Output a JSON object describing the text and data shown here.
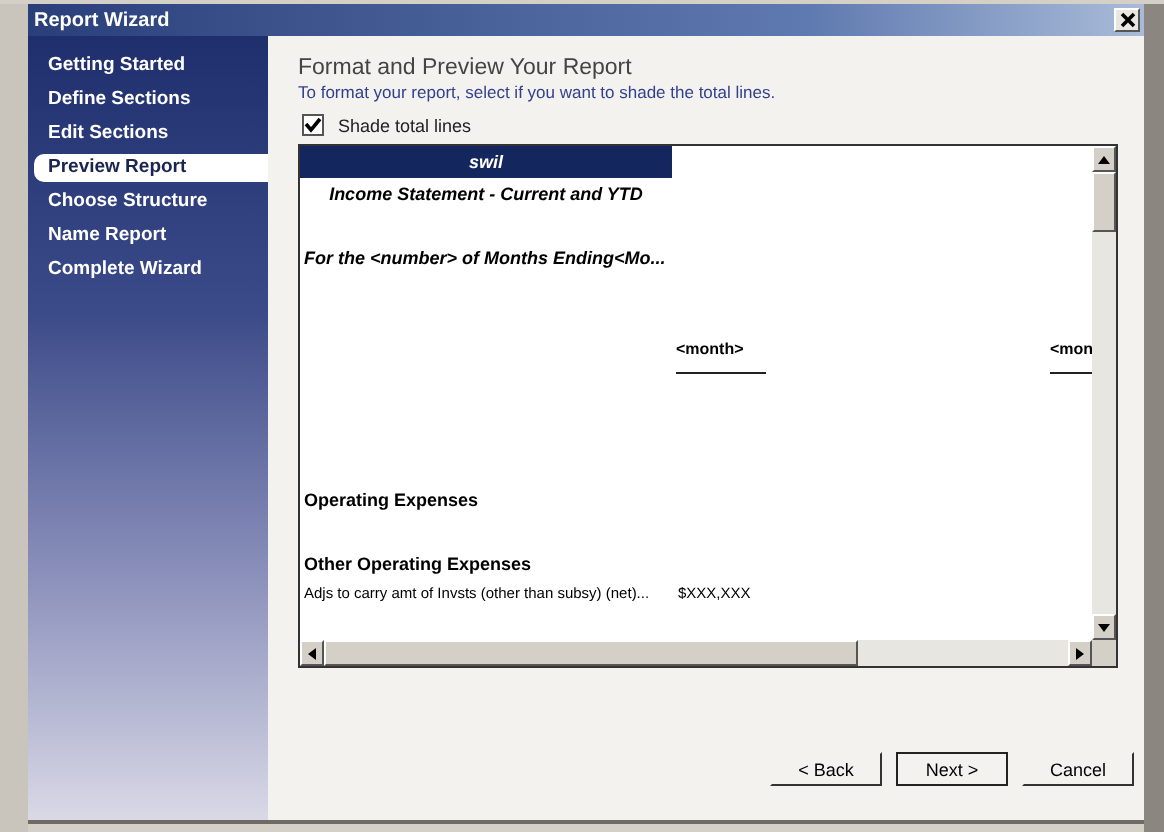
{
  "window": {
    "title": "Report Wizard"
  },
  "steps": [
    {
      "label": "Getting Started",
      "selected": false
    },
    {
      "label": "Define Sections",
      "selected": false
    },
    {
      "label": "Edit Sections",
      "selected": false
    },
    {
      "label": "Preview Report",
      "selected": true
    },
    {
      "label": "Choose Structure",
      "selected": false
    },
    {
      "label": "Name Report",
      "selected": false
    },
    {
      "label": "Complete Wizard",
      "selected": false
    }
  ],
  "heading": "Format and Preview Your Report",
  "instruction": "To format your report, select if you want to shade the total lines.",
  "shade_option": {
    "label": "Shade total lines",
    "checked": true
  },
  "preview": {
    "company": "swil",
    "title": "Income Statement - Current and YTD",
    "period": "For the <number> of Months Ending<Mo...",
    "column_headers": [
      "<month>",
      "<mon"
    ],
    "sections": [
      {
        "title": "Operating Expenses"
      },
      {
        "title": "Other Operating Expenses",
        "rows": [
          {
            "label": "Adjs to carry amt of Invsts (other than subsy) (net)...",
            "value": "$XXX,XXX"
          }
        ]
      }
    ]
  },
  "buttons": [
    {
      "label": "< Back",
      "default": false
    },
    {
      "label": "Next >",
      "default": true
    },
    {
      "label": "Cancel",
      "default": false
    }
  ]
}
